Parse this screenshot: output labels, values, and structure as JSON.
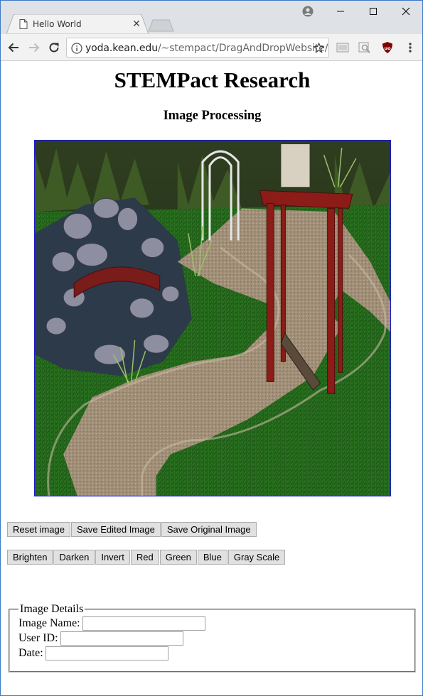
{
  "browser": {
    "tab_title": "Hello World",
    "url_host": "yoda.kean.edu",
    "url_path": "/~stempact/DragAndDropWebsite/"
  },
  "page": {
    "title": "STEMPact Research",
    "subtitle": "Image Processing"
  },
  "controls": {
    "row1": [
      "Reset image",
      "Save Edited Image",
      "Save Original Image"
    ],
    "row2": [
      "Brighten",
      "Darken",
      "Invert",
      "Red",
      "Green",
      "Blue",
      "Gray Scale"
    ]
  },
  "details": {
    "legend": "Image Details",
    "fields": [
      {
        "label": "Image Name:",
        "value": ""
      },
      {
        "label": "User ID:",
        "value": ""
      },
      {
        "label": "Date:",
        "value": ""
      }
    ]
  }
}
